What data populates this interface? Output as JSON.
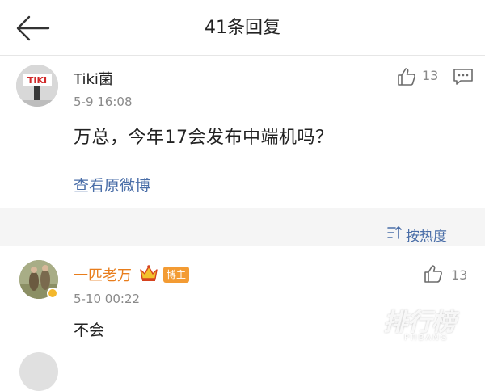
{
  "header": {
    "title": "41条回复"
  },
  "original_post": {
    "username": "Tiki菌",
    "avatar_text": "TIKI",
    "time": "5-9 16:08",
    "likes": "13",
    "content": "万总，今年17会发布中端机吗？",
    "view_original_label": "查看原微博"
  },
  "sort": {
    "label": "按热度"
  },
  "reply": {
    "username": "一匹老万",
    "badge": "博主",
    "time": "5-10 00:22",
    "likes": "13",
    "content": "不会"
  },
  "watermark": {
    "main": "排行榜",
    "sub": "PHBANG"
  }
}
